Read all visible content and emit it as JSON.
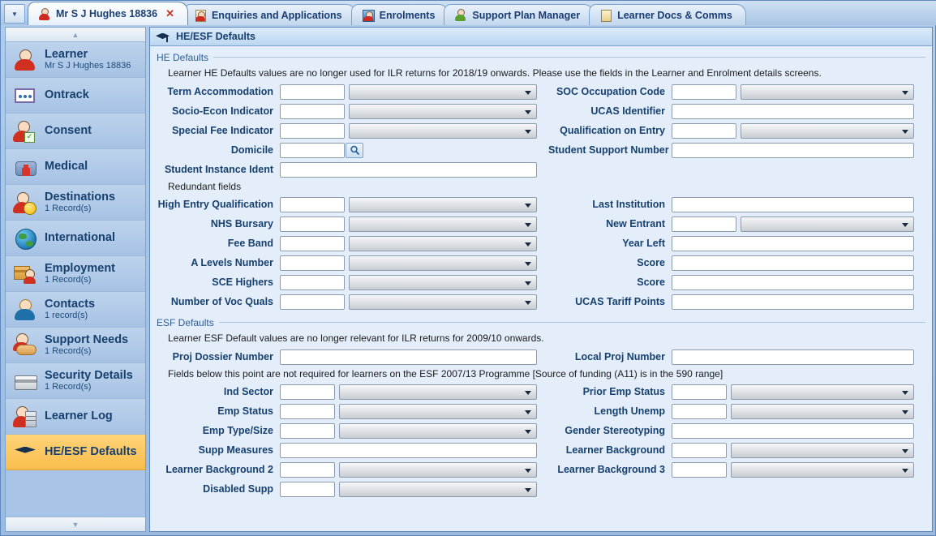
{
  "tabs": [
    {
      "label": "Mr S J Hughes 18836",
      "icon": "person-icon",
      "active": true,
      "closable": true
    },
    {
      "label": "Enquiries and Applications",
      "icon": "person-doc-icon",
      "active": false,
      "closable": false
    },
    {
      "label": "Enrolments",
      "icon": "person-card-icon",
      "active": false,
      "closable": false
    },
    {
      "label": "Support Plan Manager",
      "icon": "person-green-icon",
      "active": false,
      "closable": false
    },
    {
      "label": "Learner Docs & Comms",
      "icon": "documents-icon",
      "active": false,
      "closable": false
    }
  ],
  "tab_close_glyph": "✕",
  "tab_dropdown_glyph": "▼",
  "sidebar": {
    "scroll_up_glyph": "▲",
    "scroll_down_glyph": "▼",
    "items": [
      {
        "label": "Learner",
        "sub": "Mr S J Hughes 18836",
        "icon": "person-icon",
        "active": false
      },
      {
        "label": "Ontrack",
        "sub": "",
        "icon": "ontrack-card-icon",
        "active": false
      },
      {
        "label": "Consent",
        "sub": "",
        "icon": "person-check-icon",
        "active": false
      },
      {
        "label": "Medical",
        "sub": "",
        "icon": "medical-bag-icon",
        "active": false
      },
      {
        "label": "Destinations",
        "sub": "1 Record(s)",
        "icon": "person-smiley-icon",
        "active": false
      },
      {
        "label": "International",
        "sub": "",
        "icon": "globe-icon",
        "active": false
      },
      {
        "label": "Employment",
        "sub": "1 Record(s)",
        "icon": "employment-box-icon",
        "active": false
      },
      {
        "label": "Contacts",
        "sub": "1 record(s)",
        "icon": "contact-person-icon",
        "active": false
      },
      {
        "label": "Support Needs",
        "sub": "1 Record(s)",
        "icon": "handshake-icon",
        "active": false
      },
      {
        "label": "Security Details",
        "sub": "1 Record(s)",
        "icon": "credit-card-icon",
        "active": false
      },
      {
        "label": "Learner Log",
        "sub": "",
        "icon": "person-log-icon",
        "active": false
      },
      {
        "label": "HE/ESF Defaults",
        "sub": "",
        "icon": "graduation-cap-icon",
        "active": true
      }
    ]
  },
  "header": {
    "title": "HE/ESF Defaults",
    "icon": "graduation-cap-icon"
  },
  "he_defaults": {
    "legend": "HE Defaults",
    "note": "Learner HE Defaults values are no longer used for ILR returns for 2018/19 onwards. Please use the fields in the Learner and Enrolment details screens.",
    "left_fields": [
      {
        "label": "Term Accommodation",
        "code": "",
        "value": "",
        "type": "code-select"
      },
      {
        "label": "Socio-Econ Indicator",
        "code": "",
        "value": "",
        "type": "code-select"
      },
      {
        "label": "Special Fee Indicator",
        "code": "",
        "value": "",
        "type": "code-select"
      },
      {
        "label": "Domicile",
        "code": "",
        "value": "",
        "type": "code-lookup"
      },
      {
        "label": "Student Instance Ident",
        "code": "",
        "value": "",
        "type": "wide-text"
      }
    ],
    "right_fields": [
      {
        "label": "SOC Occupation Code",
        "code": "",
        "value": "",
        "type": "code-select"
      },
      {
        "label": "UCAS Identifier",
        "code": "",
        "value": "",
        "type": "wide-text"
      },
      {
        "label": "Qualification on Entry",
        "code": "",
        "value": "",
        "type": "code-select"
      },
      {
        "label": "Student Support Number",
        "code": "",
        "value": "",
        "type": "wide-text"
      }
    ],
    "redundant_legend": "Redundant fields",
    "redundant_left": [
      {
        "label": "High Entry Qualification",
        "code": "",
        "value": "",
        "type": "code-select"
      },
      {
        "label": "NHS Bursary",
        "code": "",
        "value": "",
        "type": "code-select"
      },
      {
        "label": "Fee Band",
        "code": "",
        "value": "",
        "type": "code-select"
      },
      {
        "label": "A Levels Number",
        "code": "",
        "value": "",
        "type": "code-select"
      },
      {
        "label": "SCE Highers",
        "code": "",
        "value": "",
        "type": "code-select"
      },
      {
        "label": "Number of Voc Quals",
        "code": "",
        "value": "",
        "type": "code-select"
      }
    ],
    "redundant_right": [
      {
        "label": "Last Institution",
        "code": "",
        "value": "",
        "type": "wide-text"
      },
      {
        "label": "New Entrant",
        "code": "",
        "value": "",
        "type": "code-select"
      },
      {
        "label": "Year Left",
        "code": "",
        "value": "",
        "type": "wide-text"
      },
      {
        "label": "Score",
        "code": "",
        "value": "",
        "type": "wide-text"
      },
      {
        "label": "Score",
        "code": "",
        "value": "",
        "type": "wide-text"
      },
      {
        "label": "UCAS Tariff Points",
        "code": "",
        "value": "",
        "type": "wide-text"
      }
    ]
  },
  "esf_defaults": {
    "legend": "ESF Defaults",
    "note": "Learner ESF Default values are no longer relevant for ILR returns for 2009/10 onwards.",
    "proj_dossier_label": "Proj Dossier Number",
    "proj_dossier_value": "",
    "local_proj_label": "Local Proj Number",
    "local_proj_value": "",
    "subnote": "Fields below this point are not required for learners on the ESF 2007/13 Programme [Source of funding (A11) is in the 590 range]",
    "left_fields": [
      {
        "label": "Ind Sector",
        "code": "",
        "value": "",
        "type": "code-select"
      },
      {
        "label": "Emp Status",
        "code": "",
        "value": "",
        "type": "code-select"
      },
      {
        "label": "Emp Type/Size",
        "code": "",
        "value": "",
        "type": "code-select"
      },
      {
        "label": "Supp Measures",
        "code": "",
        "value": "",
        "type": "wide-text"
      },
      {
        "label": "Learner Background 2",
        "code": "",
        "value": "",
        "type": "code-select"
      },
      {
        "label": "Disabled Supp",
        "code": "",
        "value": "",
        "type": "code-select"
      }
    ],
    "right_fields": [
      {
        "label": "Prior Emp Status",
        "code": "",
        "value": "",
        "type": "code-select"
      },
      {
        "label": "Length Unemp",
        "code": "",
        "value": "",
        "type": "code-select"
      },
      {
        "label": "Gender Stereotyping",
        "code": "",
        "value": "",
        "type": "wide-text"
      },
      {
        "label": "Learner Background",
        "code": "",
        "value": "",
        "type": "code-select"
      },
      {
        "label": "Learner Background 3",
        "code": "",
        "value": "",
        "type": "code-select"
      }
    ]
  },
  "colors": {
    "accent_blue": "#17406f",
    "legend_blue": "#2c5d94",
    "active_sidebar": "#f9bd4c",
    "panel_bg": "#e4eefb",
    "frame": "#5e88bd"
  }
}
